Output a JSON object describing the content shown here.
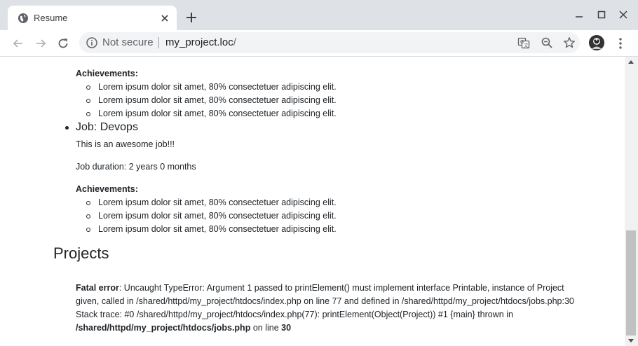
{
  "browser": {
    "tab_title": "Resume",
    "security_label": "Not secure",
    "url_host": "my_project.loc",
    "url_path": "/",
    "colors": {
      "tabstrip": "#dee1e6",
      "omnibox": "#f1f3f4",
      "icon": "#5f6368"
    }
  },
  "page": {
    "job1": {
      "achievements_label": "Achievements:",
      "achievements": [
        "Lorem ipsum dolor sit amet, 80% consectetuer adipiscing elit.",
        "Lorem ipsum dolor sit amet, 80% consectetuer adipiscing elit.",
        "Lorem ipsum dolor sit amet, 80% consectetuer adipiscing elit."
      ]
    },
    "job2": {
      "title": "Job: Devops",
      "description": "This is an awesome job!!!",
      "duration": "Job duration: 2 years 0 months",
      "achievements_label": "Achievements:",
      "achievements": [
        "Lorem ipsum dolor sit amet, 80% consectetuer adipiscing elit.",
        "Lorem ipsum dolor sit amet, 80% consectetuer adipiscing elit.",
        "Lorem ipsum dolor sit amet, 80% consectetuer adipiscing elit."
      ]
    },
    "projects_heading": "Projects",
    "error": {
      "label": "Fatal error",
      "message": ": Uncaught TypeError: Argument 1 passed to printElement() must implement interface Printable, instance of Project given, called in /shared/httpd/my_project/htdocs/index.php on line 77 and defined in /shared/httpd/my_project/htdocs/jobs.php:30 Stack trace: #0 /shared/httpd/my_project/htdocs/index.php(77): printElement(Object(Project)) #1 {main} thrown in ",
      "file": "/shared/httpd/my_project/htdocs/jobs.php",
      "on_line": " on line ",
      "line": "30"
    }
  },
  "icons": [
    "globe-icon",
    "close-icon",
    "plus-icon",
    "minimize-icon",
    "maximize-icon",
    "window-close-icon",
    "back-arrow-icon",
    "forward-arrow-icon",
    "reload-icon",
    "info-icon",
    "translate-icon",
    "zoom-out-icon",
    "star-icon",
    "avatar",
    "kebab-menu-icon"
  ]
}
